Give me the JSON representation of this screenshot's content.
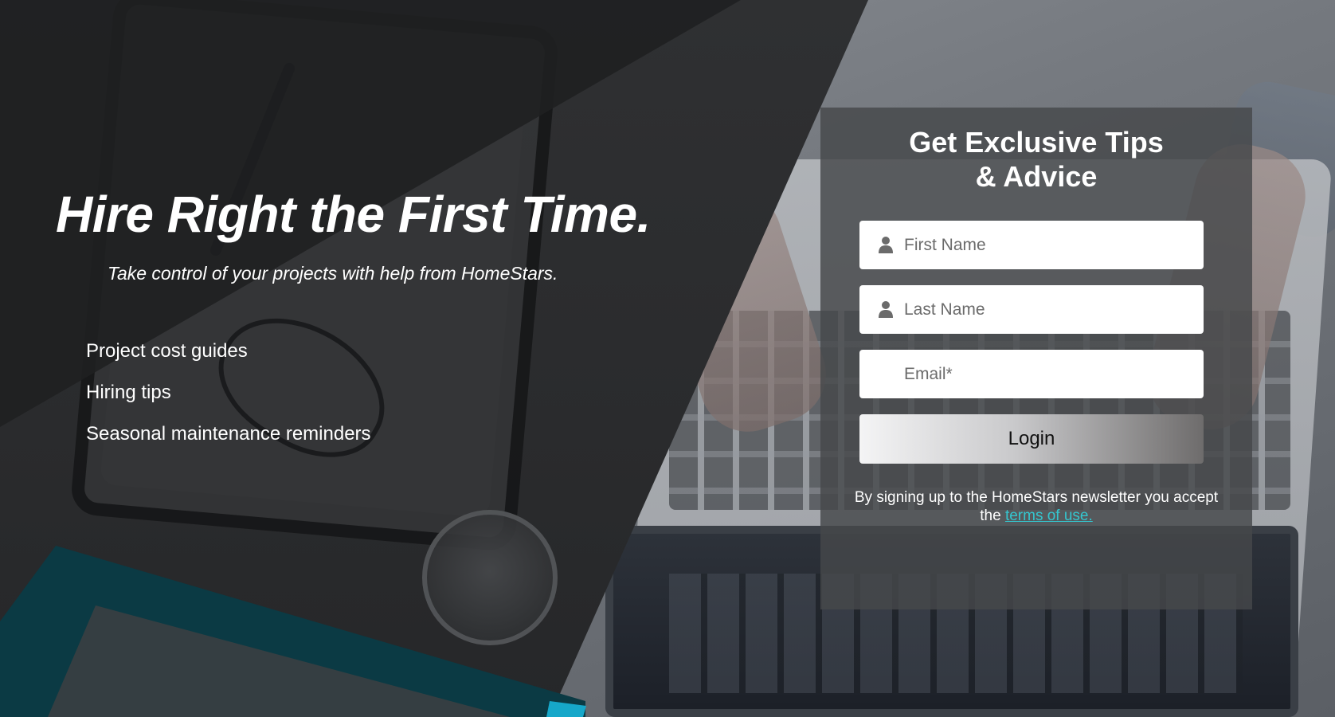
{
  "hero": {
    "title": "Hire Right the First Time.",
    "subtitle": "Take control of your projects with help from HomeStars.",
    "benefits": [
      "Project cost guides",
      "Hiring tips",
      "Seasonal maintenance reminders"
    ]
  },
  "signup": {
    "title_line1": "Get Exclusive Tips",
    "title_line2": "& Advice",
    "first_name_placeholder": "First Name",
    "last_name_placeholder": "Last Name",
    "email_placeholder": "Email*",
    "login_label": "Login",
    "disclaimer_text": "By signing up to the HomeStars newsletter you accept the ",
    "terms_link_text": "terms of use."
  },
  "colors": {
    "link": "#34c6cf",
    "card_background": "#46484b",
    "text": "#ffffff"
  },
  "icons": {
    "first_name": "user-icon",
    "last_name": "user-icon"
  }
}
